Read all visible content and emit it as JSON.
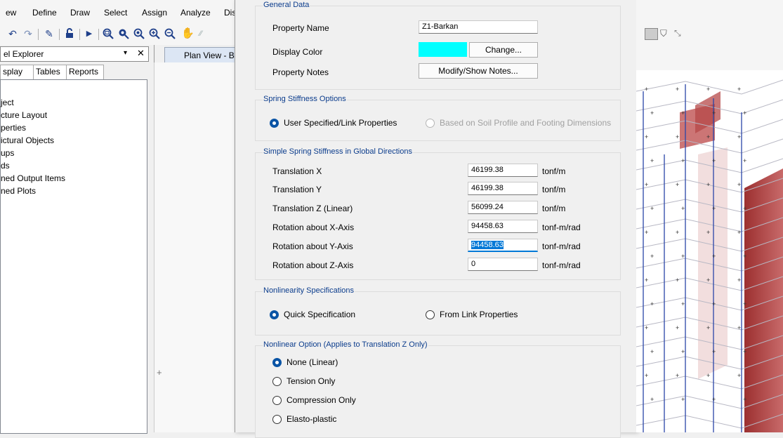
{
  "menu": {
    "view": "ew",
    "define": "Define",
    "draw": "Draw",
    "select": "Select",
    "assign": "Assign",
    "analyze": "Analyze",
    "display": "Dis"
  },
  "toolbar_icons": [
    "undo-icon",
    "redo-icon",
    "pencil-icon",
    "lock-icon",
    "run-icon",
    "zoom-window-icon",
    "zoom-in-icon",
    "zoom-out-icon",
    "zoom-fit-icon",
    "zoom-previous-icon",
    "pan-icon"
  ],
  "explorer": {
    "title": "el Explorer",
    "pin": "▾",
    "close": "✕",
    "tabs": [
      "splay",
      "Tables",
      "Reports"
    ],
    "tree": [
      "ject",
      "cture Layout",
      "perties",
      "ictural Objects",
      "ups",
      "ds",
      "ned Output Items",
      "ned Plots"
    ]
  },
  "plan_view": {
    "tab_label": "Plan View - Ba",
    "cross": "+"
  },
  "dialog": {
    "general": {
      "title": "General Data",
      "property_name_label": "Property Name",
      "property_name_value": "Z1-Barkan",
      "display_color_label": "Display Color",
      "display_color": "#00ffff",
      "change_button": "Change...",
      "property_notes_label": "Property Notes",
      "notes_button": "Modify/Show Notes..."
    },
    "spring_options": {
      "title": "Spring Stiffness Options",
      "user_specified": "User Specified/Link Properties",
      "soil_profile": "Based on Soil Profile and Footing Dimensions",
      "selected": "user_specified"
    },
    "stiffness": {
      "title": "Simple Spring Stiffness in Global Directions",
      "rows": [
        {
          "label": "Translation  X",
          "value": "46199.38",
          "unit": "tonf/m"
        },
        {
          "label": "Translation  Y",
          "value": "46199.38",
          "unit": "tonf/m"
        },
        {
          "label": "Translation  Z (Linear)",
          "value": "56099.24",
          "unit": "tonf/m"
        },
        {
          "label": "Rotation about  X-Axis",
          "value": "94458.63",
          "unit": "tonf-m/rad"
        },
        {
          "label": "Rotation about  Y-Axis",
          "value": "94458.63",
          "unit": "tonf-m/rad"
        },
        {
          "label": "Rotation about  Z-Axis",
          "value": "0",
          "unit": "tonf-m/rad"
        }
      ]
    },
    "nonlinearity": {
      "title": "Nonlinearity Specifications",
      "quick": "Quick Specification",
      "from_link": "From Link Properties",
      "selected": "quick"
    },
    "nonlinear_option": {
      "title": "Nonlinear Option  (Applies to Translation Z Only)",
      "options": [
        "None (Linear)",
        "Tension Only",
        "Compression Only",
        "Elasto-plastic"
      ],
      "selected": "None (Linear)"
    }
  },
  "colors": {
    "accent": "#0078d7",
    "radio_on": "#0a54a5",
    "group_title": "#0b3c8c",
    "wall_red": "#b84a4a",
    "frame_blue": "#1f3f9a"
  }
}
